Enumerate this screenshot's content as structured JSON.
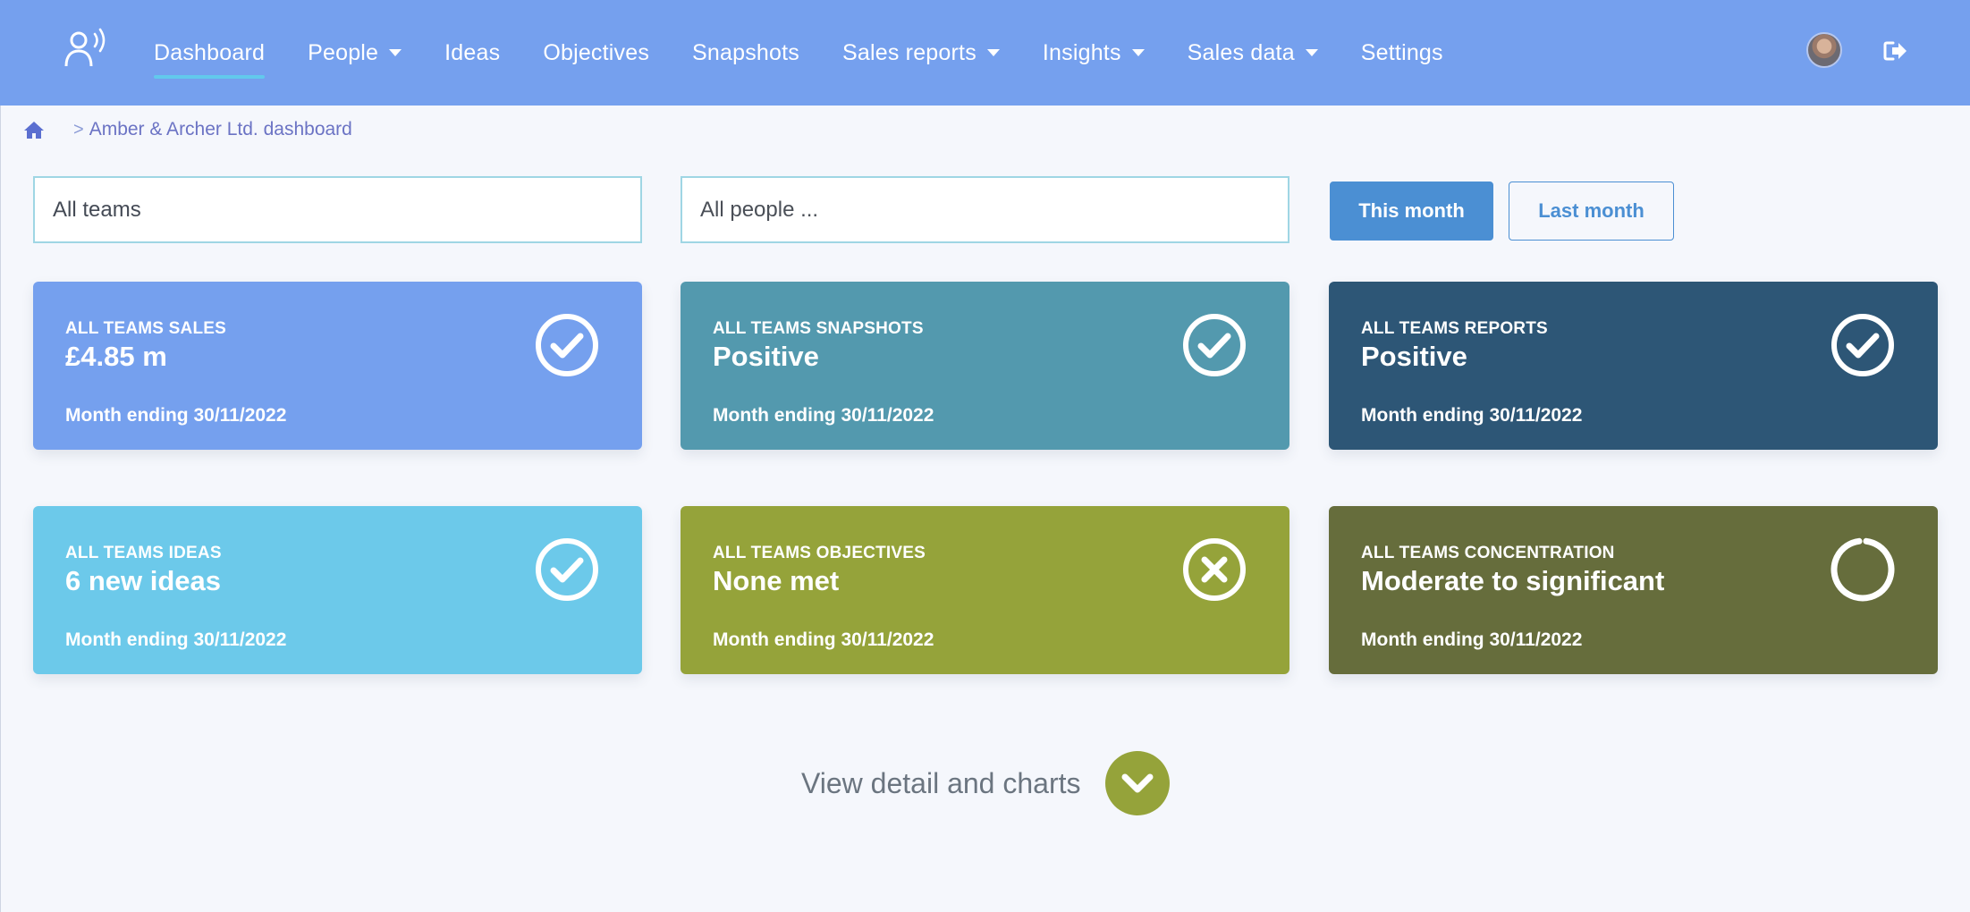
{
  "nav": {
    "items": [
      {
        "label": "Dashboard",
        "active": true,
        "dropdown": false
      },
      {
        "label": "People",
        "active": false,
        "dropdown": true
      },
      {
        "label": "Ideas",
        "active": false,
        "dropdown": false
      },
      {
        "label": "Objectives",
        "active": false,
        "dropdown": false
      },
      {
        "label": "Snapshots",
        "active": false,
        "dropdown": false
      },
      {
        "label": "Sales reports",
        "active": false,
        "dropdown": true
      },
      {
        "label": "Insights",
        "active": false,
        "dropdown": true
      },
      {
        "label": "Sales data",
        "active": false,
        "dropdown": true
      },
      {
        "label": "Settings",
        "active": false,
        "dropdown": false
      }
    ]
  },
  "breadcrumb": {
    "separator": ">",
    "current": "Amber & Archer Ltd. dashboard"
  },
  "filters": {
    "teams_value": "All teams",
    "people_placeholder": "All people ..."
  },
  "period": {
    "this_month": "This month",
    "last_month": "Last month"
  },
  "cards": [
    {
      "title": "ALL TEAMS SALES",
      "value": "£4.85 m",
      "sub": "Month ending 30/11/2022",
      "icon": "check-circle-icon",
      "color": "#75a0ee"
    },
    {
      "title": "ALL TEAMS SNAPSHOTS",
      "value": "Positive",
      "sub": "Month ending 30/11/2022",
      "icon": "check-circle-icon",
      "color": "#5399ae"
    },
    {
      "title": "ALL TEAMS REPORTS",
      "value": "Positive",
      "sub": "Month ending 30/11/2022",
      "icon": "check-circle-icon",
      "color": "#2d5676"
    },
    {
      "title": "ALL TEAMS IDEAS",
      "value": "6 new ideas",
      "sub": "Month ending 30/11/2022",
      "icon": "check-circle-icon",
      "color": "#6cc9ea"
    },
    {
      "title": "ALL TEAMS OBJECTIVES",
      "value": "None met",
      "sub": "Month ending 30/11/2022",
      "icon": "x-circle-icon",
      "color": "#95a33a"
    },
    {
      "title": "ALL TEAMS CONCENTRATION",
      "value": "Moderate to significant",
      "sub": "Month ending 30/11/2022",
      "icon": "ring-icon",
      "color": "#666d3c"
    }
  ],
  "footer": {
    "view_detail": "View detail and charts"
  }
}
